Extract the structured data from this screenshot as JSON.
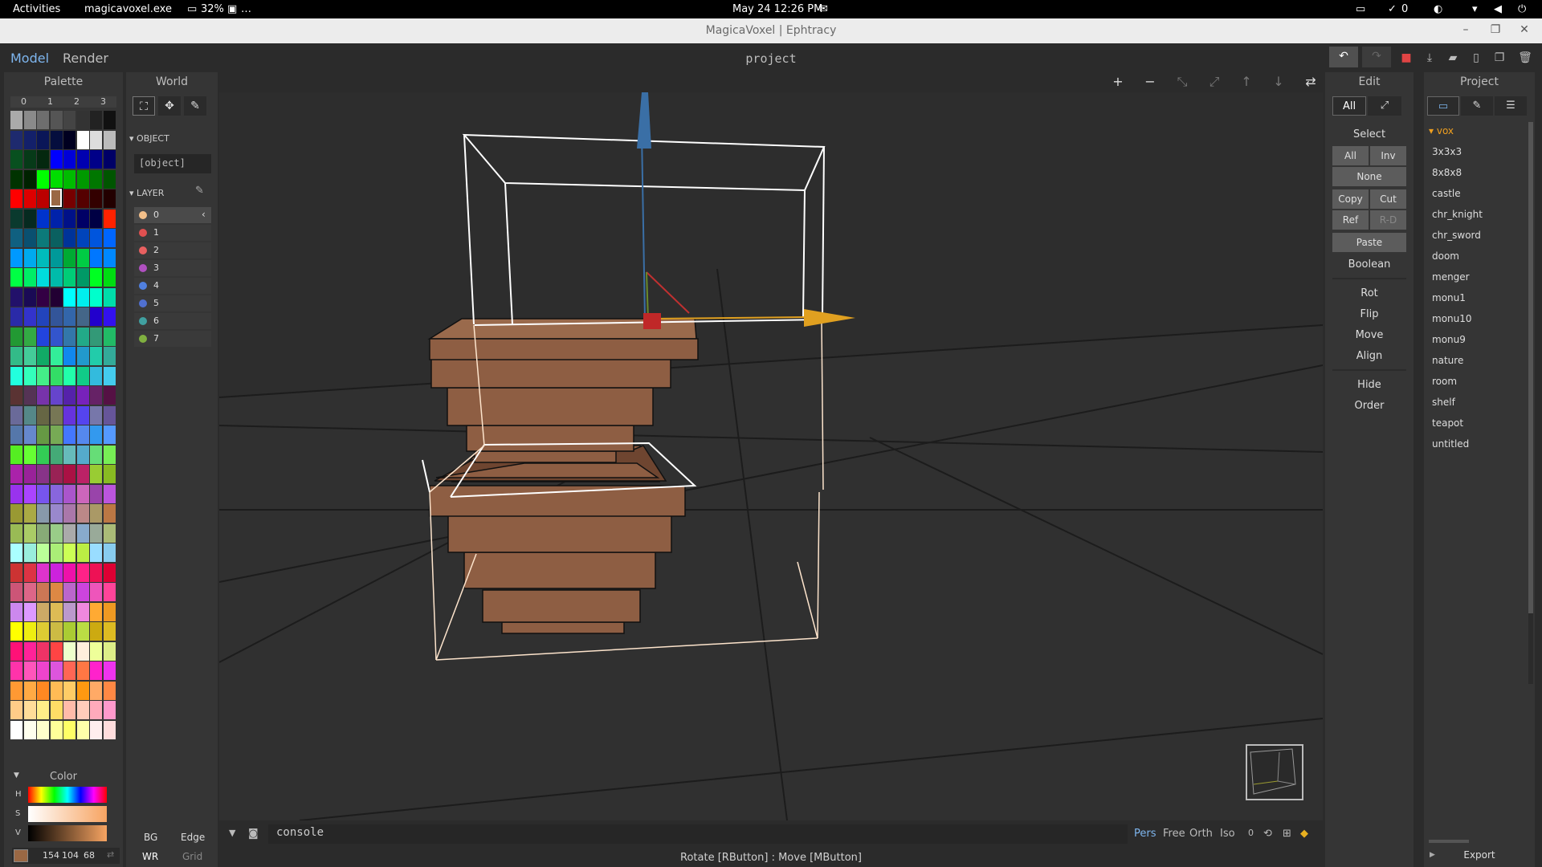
{
  "system_bar": {
    "activities": "Activities",
    "app_name": "magicavoxel.exe",
    "battery": "32%",
    "extra": "…",
    "datetime": "May 24  12:26 PM",
    "notifications": "0"
  },
  "window": {
    "title": "MagicaVoxel | Ephtracy"
  },
  "header": {
    "mode_model": "Model",
    "mode_render": "Render",
    "project_name": "project"
  },
  "palette": {
    "title": "Palette",
    "columns": [
      "0",
      "1",
      "2",
      "3"
    ],
    "selected_index": 35,
    "colors": [
      "#aaaaaa",
      "#8a8a8a",
      "#6e6e6e",
      "#555555",
      "#444444",
      "#333333",
      "#222222",
      "#111111",
      "#1e2a6e",
      "#13206a",
      "#0a1658",
      "#050e3e",
      "#000020",
      "#ffffff",
      "#dddddd",
      "#bbbbbb",
      "#08501f",
      "#063a18",
      "#04280f",
      "#0000ff",
      "#0000d8",
      "#0000b0",
      "#000088",
      "#000066",
      "#003300",
      "#002200",
      "#00ff00",
      "#00dd00",
      "#00bb00",
      "#009900",
      "#007700",
      "#005500",
      "#ff0000",
      "#dd0000",
      "#bb0000",
      "#990000",
      "#770000",
      "#550000",
      "#330000",
      "#220000",
      "#0a3a2e",
      "#062a20",
      "#0033cc",
      "#0022aa",
      "#001188",
      "#000066",
      "#000044",
      "#ff2200",
      "#106080",
      "#0a5070",
      "#0c7a7a",
      "#0a6060",
      "#003399",
      "#0044bb",
      "#0055dd",
      "#0066ff",
      "#0099ff",
      "#00aaee",
      "#00bbbb",
      "#009999",
      "#00aa33",
      "#00cc44",
      "#0077ff",
      "#0088ff",
      "#00ff44",
      "#00ee66",
      "#00dddd",
      "#00bbaa",
      "#00cc77",
      "#009966",
      "#00ff22",
      "#00dd11",
      "#22116a",
      "#1a0a55",
      "#330044",
      "#220033",
      "#00ffff",
      "#00eeee",
      "#00ffcc",
      "#00ddaa",
      "#2a2aa8",
      "#3333cc",
      "#2244bb",
      "#335599",
      "#3366aa",
      "#446688",
      "#2200cc",
      "#3311ee",
      "#229933",
      "#33aa44",
      "#2244dd",
      "#3355cc",
      "#3377aa",
      "#22aa88",
      "#339977",
      "#22bb66",
      "#33bb88",
      "#44cc99",
      "#11aa66",
      "#33ee99",
      "#1188ee",
      "#2299cc",
      "#22ccaa",
      "#33aa99",
      "#22ffdd",
      "#33ffbb",
      "#44ee88",
      "#33dd66",
      "#22ffaa",
      "#11cc88",
      "#33bbdd",
      "#44ccee",
      "#5a3333",
      "#553355",
      "#7733aa",
      "#6644cc",
      "#5522aa",
      "#7722bb",
      "#662266",
      "#551144",
      "#6a6a99",
      "#558888",
      "#666644",
      "#777755",
      "#6633dd",
      "#5544ee",
      "#7777aa",
      "#665599",
      "#5577aa",
      "#6688cc",
      "#669944",
      "#77aa55",
      "#4477ff",
      "#5588ee",
      "#3399ee",
      "#5599ff",
      "#55ee22",
      "#66ff33",
      "#33cc55",
      "#44aa77",
      "#66bbbb",
      "#55aacc",
      "#66dd77",
      "#77ee55",
      "#aa22aa",
      "#992299",
      "#883388",
      "#992255",
      "#aa1144",
      "#bb2266",
      "#99cc33",
      "#88bb22",
      "#9933ee",
      "#aa44ff",
      "#7755ee",
      "#8866dd",
      "#aa55cc",
      "#cc66bb",
      "#9944aa",
      "#bb55dd",
      "#999933",
      "#aaaa44",
      "#8899aa",
      "#9988cc",
      "#aa77aa",
      "#bb8888",
      "#aa9966",
      "#bb7744",
      "#99bb55",
      "#aacc66",
      "#88aa77",
      "#99cc88",
      "#aaaaaa",
      "#88aacc",
      "#99aa99",
      "#aabb77",
      "#aaffff",
      "#99eedd",
      "#bbff99",
      "#aaee77",
      "#ccff55",
      "#bbee44",
      "#99ddff",
      "#88ccee",
      "#cc3333",
      "#dd3344",
      "#dd33cc",
      "#cc22dd",
      "#ee11aa",
      "#ff2288",
      "#ee1155",
      "#dd0033",
      "#cc5577",
      "#dd6688",
      "#cc7755",
      "#dd8844",
      "#bb66cc",
      "#cc44dd",
      "#ee55bb",
      "#ff4499",
      "#cc88ee",
      "#dd99ff",
      "#ccaa66",
      "#ddbb55",
      "#bb99cc",
      "#ee88dd",
      "#ffaa33",
      "#ee9922",
      "#ffff00",
      "#eeee11",
      "#ddcc33",
      "#ccbb44",
      "#aacc33",
      "#bbdd44",
      "#ccaa11",
      "#ddbb22",
      "#ff1177",
      "#ff2299",
      "#ee3366",
      "#ff4444",
      "#eeffcc",
      "#ffeedd",
      "#eeff99",
      "#ddee88",
      "#ff33aa",
      "#ff55bb",
      "#ee44cc",
      "#dd55dd",
      "#ff6655",
      "#ff7744",
      "#ff22cc",
      "#ee33ee",
      "#ff9933",
      "#ffaa44",
      "#ff8822",
      "#ffbb55",
      "#ffcc66",
      "#ff9911",
      "#ffaa66",
      "#ff8844",
      "#ffcc88",
      "#ffdd99",
      "#ffee88",
      "#ffdd66",
      "#ffbbaa",
      "#ffccbb",
      "#ffaabb",
      "#ff99cc",
      "#ffffff",
      "#ffffee",
      "#ffffcc",
      "#ffff99",
      "#ffff66",
      "#ffffaa",
      "#ffeeee",
      "#ffdddd"
    ],
    "tools": [
      "download-icon",
      "folder-icon",
      "file-icon"
    ]
  },
  "color": {
    "title": "Color",
    "h_label": "H",
    "s_label": "S",
    "v_label": "V",
    "r": "154",
    "g": "104",
    "b": "68",
    "current_color": "#9a6844"
  },
  "world": {
    "title": "World",
    "object_section": "OBJECT",
    "object_value": "[object]",
    "layer_section": "LAYER",
    "layers": [
      {
        "name": "0",
        "color": "#f4c08a"
      },
      {
        "name": "1",
        "color": "#e05050"
      },
      {
        "name": "2",
        "color": "#e86060"
      },
      {
        "name": "3",
        "color": "#b050c0"
      },
      {
        "name": "4",
        "color": "#5080e0"
      },
      {
        "name": "5",
        "color": "#5070d0"
      },
      {
        "name": "6",
        "color": "#40a0a0"
      },
      {
        "name": "7",
        "color": "#80b040"
      }
    ],
    "bg_label": "BG",
    "edge_label": "Edge",
    "wr_label": "WR",
    "grid_label": "Grid"
  },
  "console": {
    "placeholder": "console"
  },
  "camera": {
    "pers": "Pers",
    "free": "Free",
    "orth": "Orth",
    "iso": "Iso",
    "count": "0"
  },
  "status": {
    "hint": "Rotate [RButton] : Move [MButton]"
  },
  "edit": {
    "title": "Edit",
    "tab_all": "All",
    "select_label": "Select",
    "all": "All",
    "inv": "Inv",
    "none": "None",
    "copy": "Copy",
    "cut": "Cut",
    "ref": "Ref",
    "rd": "R-D",
    "paste": "Paste",
    "boolean": "Boolean",
    "rot": "Rot",
    "flip": "Flip",
    "move": "Move",
    "align": "Align",
    "hide": "Hide",
    "order": "Order"
  },
  "project": {
    "title": "Project",
    "folder": "vox",
    "files": [
      "3x3x3",
      "8x8x8",
      "castle",
      "chr_knight",
      "chr_sword",
      "doom",
      "menger",
      "monu1",
      "monu10",
      "monu9",
      "nature",
      "room",
      "shelf",
      "teapot",
      "untitled"
    ],
    "export": "Export"
  }
}
